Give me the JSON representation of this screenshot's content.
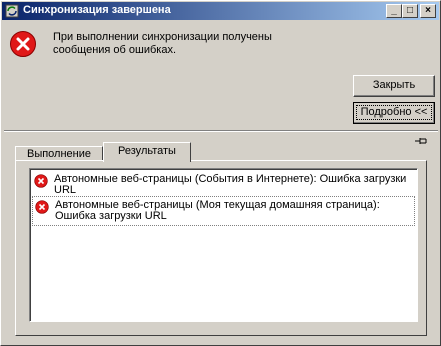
{
  "window": {
    "title": "Синхронизация завершена"
  },
  "titlebar_buttons": {
    "minimize": "_",
    "maximize": "□",
    "close": "×"
  },
  "message": "При выполнении синхронизации получены сообщения об ошибках.",
  "buttons": {
    "close_label": "Закрыть",
    "details_label": "Подробно <<"
  },
  "tabs": [
    {
      "label": "Выполнение"
    },
    {
      "label": "Результаты"
    }
  ],
  "results": [
    {
      "text": "Автономные веб-страницы (События в Интернете): Ошибка загрузки URL"
    },
    {
      "text": "Автономные веб-страницы (Моя текущая домашняя страница): Ошибка загрузки URL"
    }
  ],
  "icons": {
    "title_icon": "sync-icon",
    "error_icon": "error-icon",
    "pin_icon": "pin-icon"
  },
  "colors": {
    "title_start": "#0a246a",
    "title_end": "#a6caf0",
    "error_red": "#e01818"
  }
}
